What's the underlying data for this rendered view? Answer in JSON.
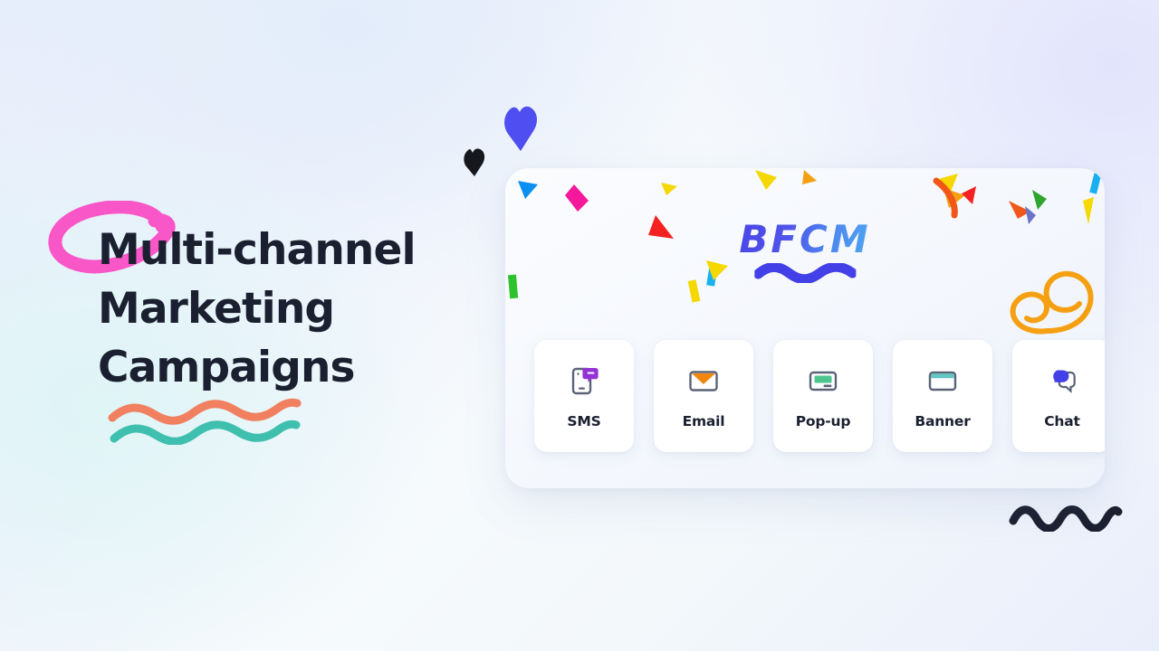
{
  "headline": {
    "text": "Multi-channel\nMarketing\nCampaigns"
  },
  "panel": {
    "brand": {
      "wordmark": "BFCM"
    },
    "channels": [
      {
        "label": "SMS",
        "icon": "phone-chat-icon"
      },
      {
        "label": "Email",
        "icon": "envelope-icon"
      },
      {
        "label": "Pop-up",
        "icon": "popup-window-icon"
      },
      {
        "label": "Banner",
        "icon": "banner-window-icon"
      },
      {
        "label": "Chat",
        "icon": "chat-bubbles-icon"
      }
    ]
  },
  "decorations": {
    "pink_loop": "pink-loop-scribble",
    "underline_orange": "orange-wave-underline",
    "underline_teal": "teal-wave-underline",
    "heart_blue": "blue-heart-icon",
    "heart_black": "black-heart-icon",
    "wave_navy": "navy-wave-squiggle",
    "ribbon_orange": "orange-curly-ribbon"
  },
  "colors": {
    "headline_text": "#1b2030",
    "pink_loop": "#f957c8",
    "underline_orange": "#f0805f",
    "underline_teal": "#3fbfae",
    "brand_blue_start": "#4a46e6",
    "brand_blue_end": "#4fa6f2",
    "heart_blue": "#4f4ef0",
    "heart_black": "#15171d",
    "wave_navy": "#1b2030",
    "icon_outline": "#5b6377",
    "sms_accent": "#9333d6",
    "email_accent": "#f2870f",
    "popup_accent": "#4ec58c",
    "banner_accent": "#5fc4c0",
    "chat_accent": "#4340e8",
    "panel_bg": "#f5f8fd",
    "tile_bg": "#ffffff"
  }
}
